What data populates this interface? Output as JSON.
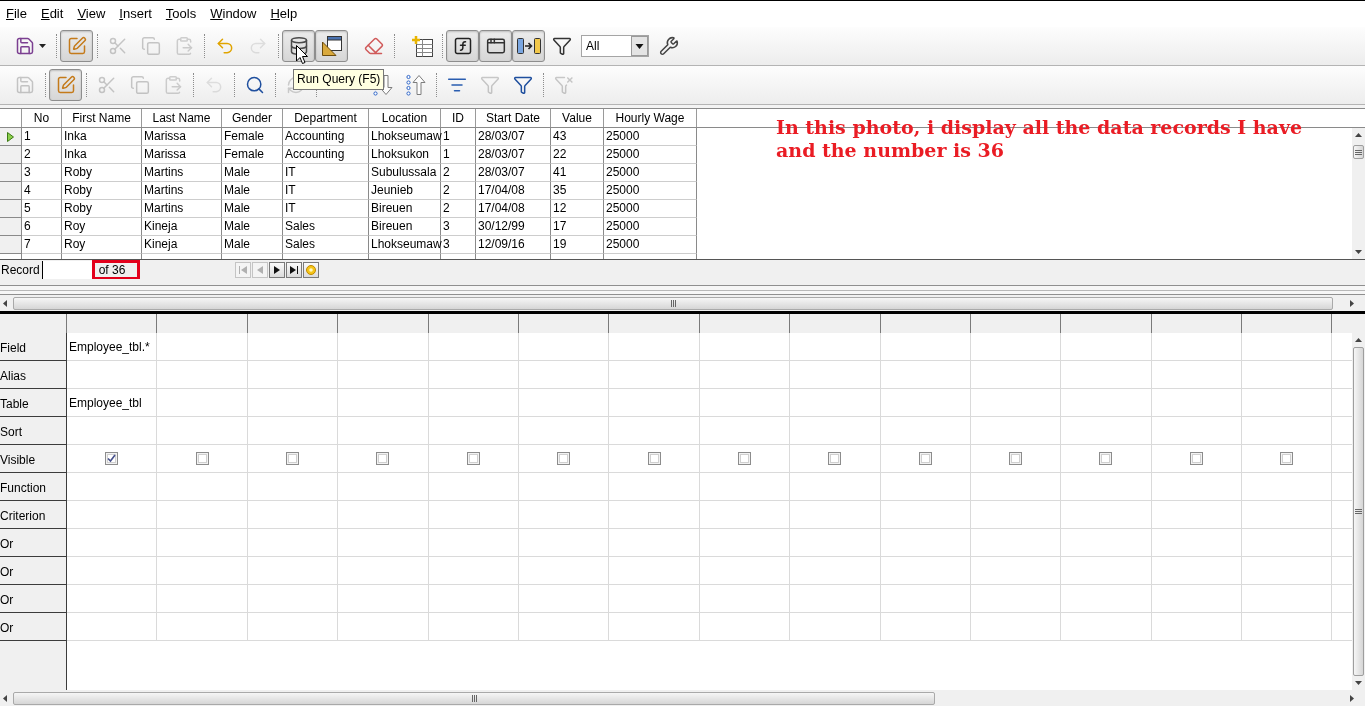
{
  "menu": [
    "File",
    "Edit",
    "View",
    "Insert",
    "Tools",
    "Window",
    "Help"
  ],
  "toolbar_1": {
    "groups": [
      [
        {
          "kind": "button",
          "pressed": false,
          "disabled": false
        }
      ],
      [
        {
          "kind": "button",
          "pressed": true,
          "disabled": false
        }
      ],
      [
        {
          "kind": "button",
          "pressed": false,
          "disabled": true
        },
        {
          "kind": "button",
          "pressed": false,
          "disabled": true
        },
        {
          "kind": "button",
          "pressed": false,
          "disabled": true
        }
      ],
      [
        {
          "kind": "button",
          "pressed": false,
          "disabled": false
        },
        {
          "kind": "button",
          "pressed": false,
          "disabled": true
        }
      ],
      [
        {
          "kind": "button",
          "pressed": true,
          "disabled": false
        },
        {
          "kind": "button",
          "pressed": true,
          "disabled": false
        },
        {
          "kind": "button",
          "pressed": false,
          "disabled": false
        }
      ],
      [
        {
          "kind": "button",
          "pressed": false,
          "disabled": false
        }
      ],
      [
        {
          "kind": "button",
          "pressed": true,
          "disabled": false
        },
        {
          "kind": "button",
          "pressed": true,
          "disabled": false
        },
        {
          "kind": "button",
          "pressed": true,
          "disabled": false
        },
        {
          "kind": "button",
          "pressed": false,
          "disabled": false
        },
        {
          "kind": "dropdown",
          "value": "All"
        },
        {
          "kind": "button",
          "pressed": false,
          "disabled": false
        }
      ]
    ]
  },
  "toolbar_2": {
    "groups": [
      [
        {
          "kind": "button",
          "pressed": false,
          "disabled": true
        }
      ],
      [
        {
          "kind": "button",
          "pressed": true,
          "disabled": false
        }
      ],
      [
        {
          "kind": "button",
          "pressed": false,
          "disabled": true
        },
        {
          "kind": "button",
          "pressed": false,
          "disabled": true
        },
        {
          "kind": "button",
          "pressed": false,
          "disabled": true
        }
      ],
      [
        {
          "kind": "button",
          "pressed": false,
          "disabled": true
        }
      ],
      [
        {
          "kind": "button",
          "pressed": false,
          "disabled": false
        }
      ],
      [
        {
          "kind": "button",
          "pressed": false,
          "disabled": true
        }
      ],
      [
        {
          "kind": "button",
          "pressed": false,
          "disabled": false
        },
        {
          "kind": "button",
          "pressed": false,
          "disabled": false
        }
      ],
      [
        {
          "kind": "button",
          "pressed": false,
          "disabled": false
        },
        {
          "kind": "button",
          "pressed": false,
          "disabled": true
        },
        {
          "kind": "button",
          "pressed": false,
          "disabled": false
        }
      ],
      [
        {
          "kind": "button",
          "pressed": false,
          "disabled": true
        }
      ]
    ]
  },
  "tooltip": {
    "text": "Run Query (F5)"
  },
  "data_grid": {
    "columns": [
      "No",
      "First Name",
      "Last Name",
      "Gender",
      "Department",
      "Location",
      "ID",
      "Start Date",
      "Value",
      "Hourly Wage"
    ],
    "rows": [
      {
        "selected": true,
        "cells": [
          "1",
          "Inka",
          "Marissa",
          "Female",
          "Accounting",
          "Lhokseumaw",
          "1",
          "28/03/07",
          "43",
          "25000"
        ]
      },
      {
        "selected": false,
        "cells": [
          "2",
          "Inka",
          "Marissa",
          "Female",
          "Accounting",
          "Lhoksukon",
          "1",
          "28/03/07",
          "22",
          "25000"
        ]
      },
      {
        "selected": false,
        "cells": [
          "3",
          "Roby",
          "Martins",
          "Male",
          "IT",
          "Subulussala",
          "2",
          "28/03/07",
          "41",
          "25000"
        ]
      },
      {
        "selected": false,
        "cells": [
          "4",
          "Roby",
          "Martins",
          "Male",
          "IT",
          "Jeunieb",
          "2",
          "17/04/08",
          "35",
          "25000"
        ]
      },
      {
        "selected": false,
        "cells": [
          "5",
          "Roby",
          "Martins",
          "Male",
          "IT",
          "Bireuen",
          "2",
          "17/04/08",
          "12",
          "25000"
        ]
      },
      {
        "selected": false,
        "cells": [
          "6",
          "Roy",
          "Kineja",
          "Male",
          "Sales",
          "Bireuen",
          "3",
          "30/12/99",
          "17",
          "25000"
        ]
      },
      {
        "selected": false,
        "cells": [
          "7",
          "Roy",
          "Kineja",
          "Male",
          "Sales",
          "Lhokseumaw",
          "3",
          "12/09/16",
          "19",
          "25000"
        ]
      }
    ]
  },
  "annotation": {
    "text": "In this photo, i display all the data records I have and the number is 36"
  },
  "record_bar": {
    "label": "Record",
    "count": "of 36",
    "count_highlighted": true,
    "nav_buttons": [
      {
        "disabled": true
      },
      {
        "disabled": true
      },
      {
        "disabled": false
      },
      {
        "disabled": false
      },
      {
        "disabled": false
      }
    ]
  },
  "query_grid": {
    "rows": [
      {
        "label": "Field",
        "kind": "field"
      },
      {
        "label": "Alias",
        "kind": "alias"
      },
      {
        "label": "Table",
        "kind": "table"
      },
      {
        "label": "Sort",
        "kind": "sort"
      },
      {
        "label": "Visible",
        "kind": "visible"
      },
      {
        "label": "Function",
        "kind": "function"
      },
      {
        "label": "Criterion",
        "kind": "criterion"
      },
      {
        "label": "Or",
        "kind": "or"
      },
      {
        "label": "Or",
        "kind": "or"
      },
      {
        "label": "Or",
        "kind": "or"
      },
      {
        "label": "Or",
        "kind": "or"
      }
    ],
    "columns": [
      {
        "field": "Employee_tbl.*",
        "table": "Employee_tbl",
        "visible": true
      },
      {
        "visible": false
      },
      {
        "visible": false
      },
      {
        "visible": false
      },
      {
        "visible": false
      },
      {
        "visible": false
      },
      {
        "visible": false
      },
      {
        "visible": false
      },
      {
        "visible": false
      },
      {
        "visible": false
      },
      {
        "visible": false
      },
      {
        "visible": false
      },
      {
        "visible": false
      },
      {
        "visible": false
      }
    ]
  }
}
